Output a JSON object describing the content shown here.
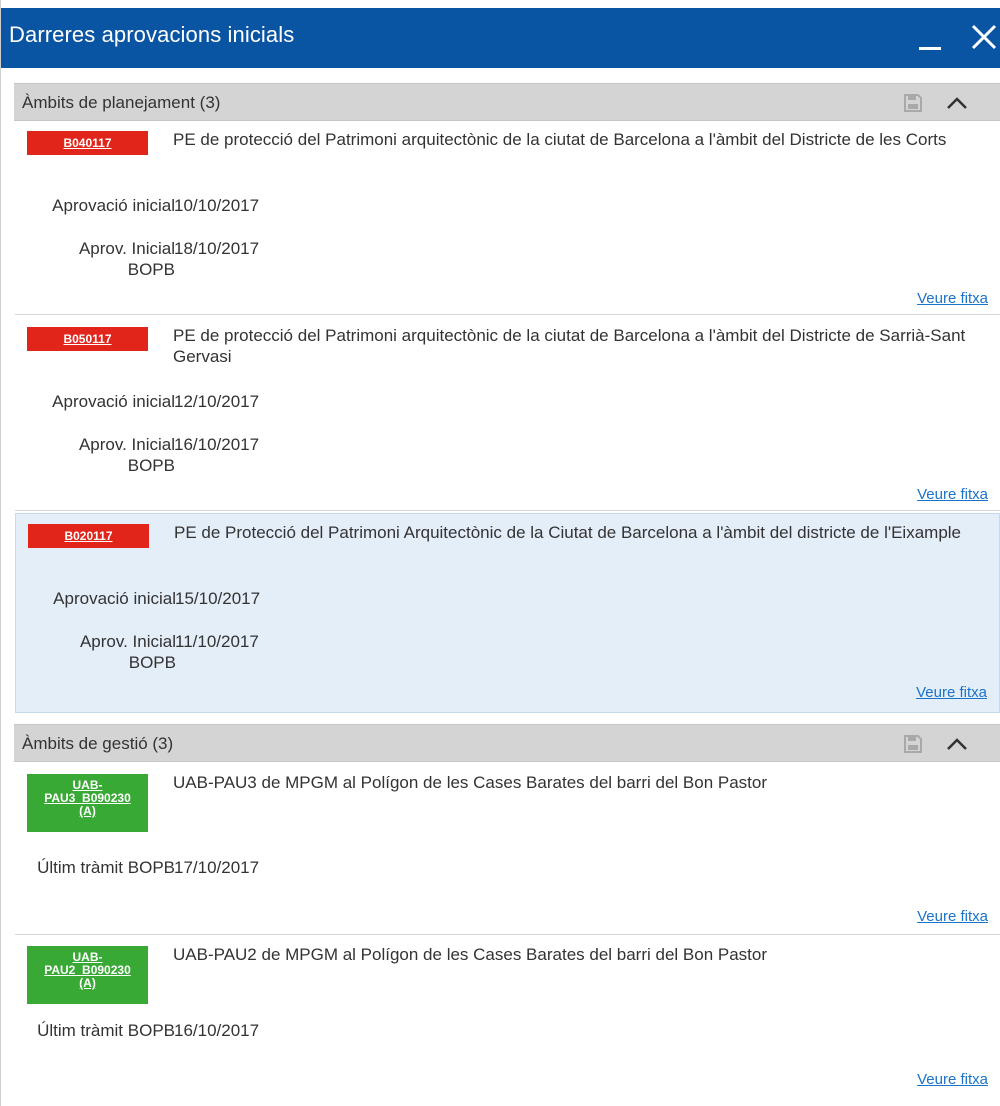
{
  "window": {
    "title": "Darreres aprovacions inicials"
  },
  "sections": {
    "planejament": {
      "title": "Àmbits de planejament (3)",
      "items": [
        {
          "code": "B040117",
          "description": "PE de protecció del Patrimoni arquitectònic de la ciutat de Barcelona a l'àmbit del Districte de les Corts",
          "fields": [
            {
              "label": "Aprovació inicial",
              "value": "10/10/2017"
            },
            {
              "label": "Aprov. Inicial BOPB",
              "value": "18/10/2017"
            }
          ],
          "link": "Veure fitxa"
        },
        {
          "code": "B050117",
          "description": "PE de protecció del Patrimoni arquitectònic de la ciutat de Barcelona a l'àmbit del Districte de Sarrià-Sant Gervasi",
          "fields": [
            {
              "label": "Aprovació inicial",
              "value": "12/10/2017"
            },
            {
              "label": "Aprov. Inicial BOPB",
              "value": "16/10/2017"
            }
          ],
          "link": "Veure fitxa"
        },
        {
          "code": "B020117",
          "description": "PE de Protecció del Patrimoni Arquitectònic de la Ciutat de Barcelona a l'àmbit del districte de l'Eixample",
          "fields": [
            {
              "label": "Aprovació inicial",
              "value": "15/10/2017"
            },
            {
              "label": "Aprov. Inicial BOPB",
              "value": "11/10/2017"
            }
          ],
          "link": "Veure fitxa"
        }
      ]
    },
    "gestio": {
      "title": "Àmbits de gestió (3)",
      "items": [
        {
          "code": "UAB-PAU3_B090230 (A)",
          "code_lines": [
            "UAB-",
            "PAU3_B090230",
            "(A)"
          ],
          "description": "UAB-PAU3 de MPGM al Polígon de les Cases Barates del barri del Bon Pastor",
          "fields": [
            {
              "label": "Últim tràmit BOPB",
              "value": "17/10/2017"
            }
          ],
          "link": "Veure fitxa"
        },
        {
          "code": "UAB-PAU2_B090230 (A)",
          "code_lines": [
            "UAB-",
            "PAU2_B090230",
            "(A)"
          ],
          "description": "UAB-PAU2 de MPGM al Polígon de les Cases Barates del barri del Bon Pastor",
          "fields": [
            {
              "label": "Últim tràmit BOPB",
              "value": "16/10/2017"
            }
          ],
          "link": "Veure fitxa"
        }
      ]
    }
  },
  "colors": {
    "titlebar": "#0a55a3",
    "planejament_code": "#e1251b",
    "gestio_code": "#39a935",
    "link": "#1b73c9",
    "highlight": "#e4eef8",
    "section_header": "#d4d4d4"
  },
  "icons": {
    "minimize": "minimize-icon",
    "close": "close-icon",
    "save": "save-icon",
    "collapse": "chevron-up-icon"
  }
}
